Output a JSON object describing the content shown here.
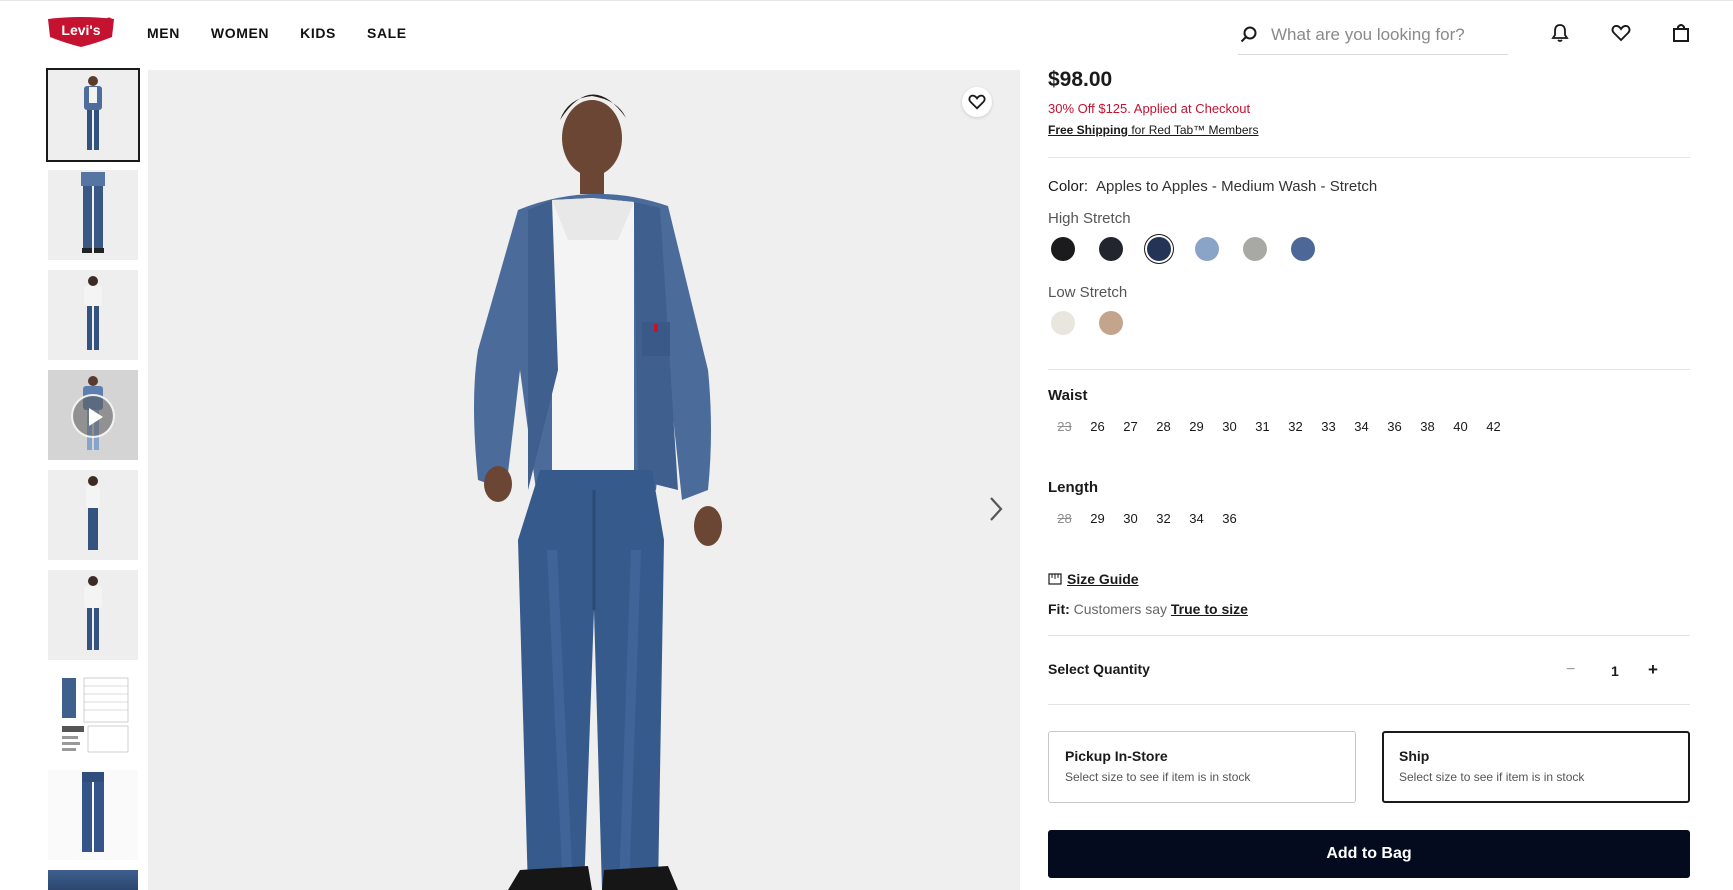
{
  "header": {
    "logo_text": "Levi's",
    "nav": [
      "MEN",
      "WOMEN",
      "KIDS",
      "SALE"
    ],
    "search_placeholder": "What are you looking for?"
  },
  "product": {
    "price": "$98.00",
    "promo": "30% Off $125. Applied at Checkout",
    "free_shipping": "Free Shipping",
    "shipping_suffix": " for Red Tab™ Members",
    "color_label": "Color:",
    "color_value": "Apples to Apples - Medium Wash - Stretch",
    "high_stretch_label": "High Stretch",
    "low_stretch_label": "Low Stretch",
    "high_stretch_swatches": [
      "#1b1b1d",
      "#22242e",
      "#233457",
      "#8aa4c8",
      "#a8a8a4",
      "#4d6896"
    ],
    "low_stretch_swatches": [
      "#e9e6df",
      "#c3a58d"
    ],
    "selected_swatch_index": 2,
    "waist_label": "Waist",
    "waist_sizes": [
      "23",
      "26",
      "27",
      "28",
      "29",
      "30",
      "31",
      "32",
      "33",
      "34",
      "36",
      "38",
      "40",
      "42"
    ],
    "waist_unavailable": [
      "23"
    ],
    "length_label": "Length",
    "length_sizes": [
      "28",
      "29",
      "30",
      "32",
      "34",
      "36"
    ],
    "length_unavailable": [
      "28"
    ],
    "size_guide": "Size Guide",
    "fit_label": "Fit:",
    "fit_says": " Customers say ",
    "fit_value": "True to size",
    "quantity_label": "Select Quantity",
    "quantity_minus": "−",
    "quantity": "1",
    "quantity_plus": "+",
    "pickup_title": "Pickup In-Store",
    "pickup_sub": "Select size to see if item is in stock",
    "ship_title": "Ship",
    "ship_sub": "Select size to see if item is in stock",
    "add_to_bag": "Add to Bag"
  },
  "colors": {
    "brand_red": "#c41230",
    "button_dark": "#050b1e"
  }
}
